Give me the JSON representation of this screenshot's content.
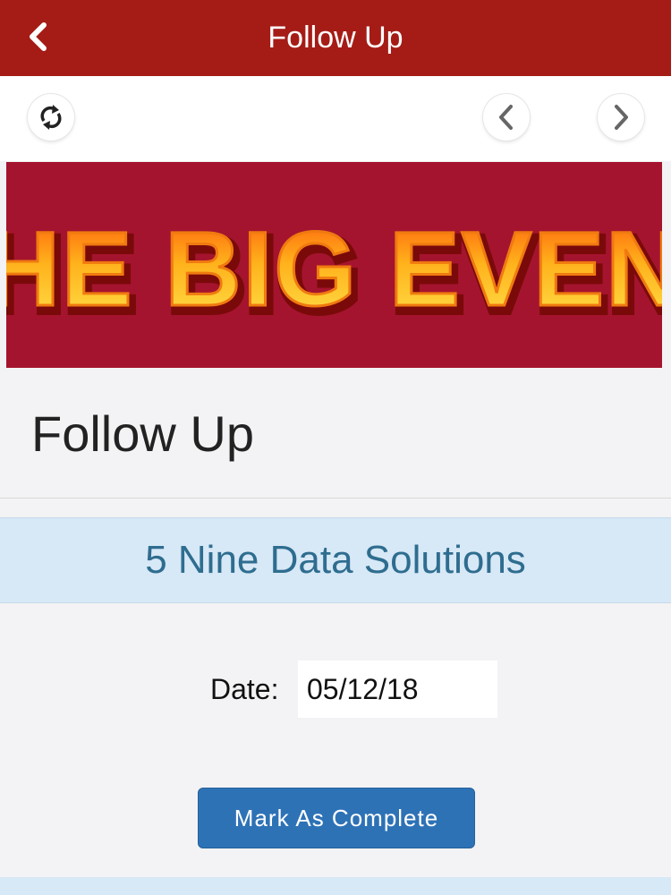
{
  "header": {
    "title": "Follow Up",
    "back_icon": "chevron-left-icon",
    "background": "#a51c16"
  },
  "toolbar": {
    "refresh_icon": "refresh-icon",
    "prev_icon": "chevron-left-icon",
    "next_icon": "chevron-right-icon"
  },
  "banner": {
    "text": "THE BIG EVENT",
    "background": "#a5142e"
  },
  "page": {
    "title": "Follow Up",
    "company": "5 Nine Data Solutions",
    "date_label": "Date:",
    "date_value": "05/12/18",
    "complete_button": "Mark As Complete"
  }
}
